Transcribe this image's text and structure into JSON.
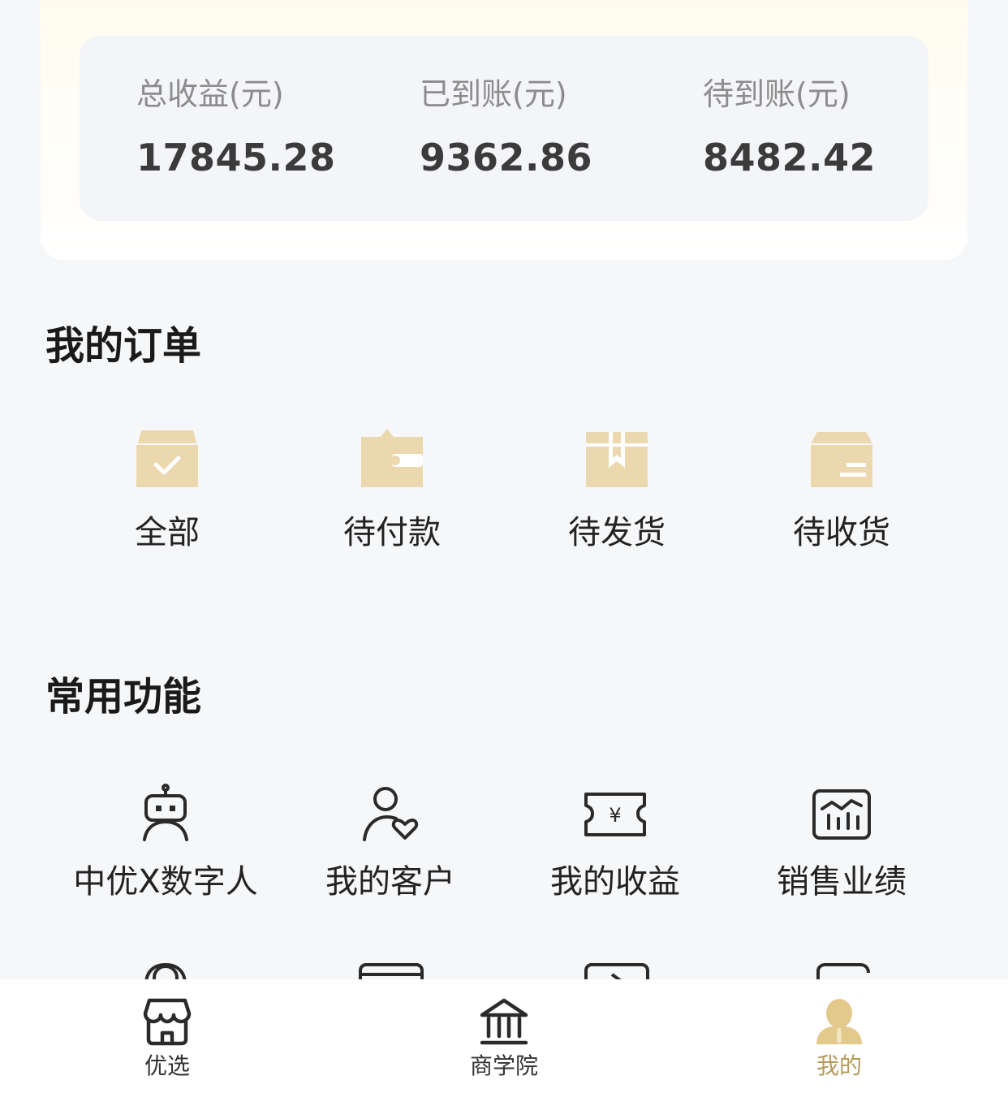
{
  "earnings": {
    "total_label": "总收益(元)",
    "total_value": "17845.28",
    "received_label": "已到账(元)",
    "received_value": "9362.86",
    "pending_label": "待到账(元)",
    "pending_value": "8482.42"
  },
  "orders": {
    "title": "我的订单",
    "items": [
      {
        "label": "全部",
        "icon": "box-check-icon"
      },
      {
        "label": "待付款",
        "icon": "wallet-icon"
      },
      {
        "label": "待发货",
        "icon": "package-icon"
      },
      {
        "label": "待收货",
        "icon": "card-receive-icon"
      }
    ]
  },
  "functions": {
    "title": "常用功能",
    "items": [
      {
        "label": "中优X数字人",
        "icon": "robot-icon"
      },
      {
        "label": "我的客户",
        "icon": "user-heart-icon"
      },
      {
        "label": "我的收益",
        "icon": "ticket-yuan-icon"
      },
      {
        "label": "销售业绩",
        "icon": "chart-icon"
      }
    ]
  },
  "tabbar": {
    "items": [
      {
        "label": "优选",
        "icon": "store-icon",
        "active": false
      },
      {
        "label": "商学院",
        "icon": "institution-icon",
        "active": false
      },
      {
        "label": "我的",
        "icon": "person-icon",
        "active": true
      }
    ]
  },
  "colors": {
    "accent": "#b59a5a",
    "order_icon": "#ecd8ae",
    "background": "#f6f7f9"
  }
}
